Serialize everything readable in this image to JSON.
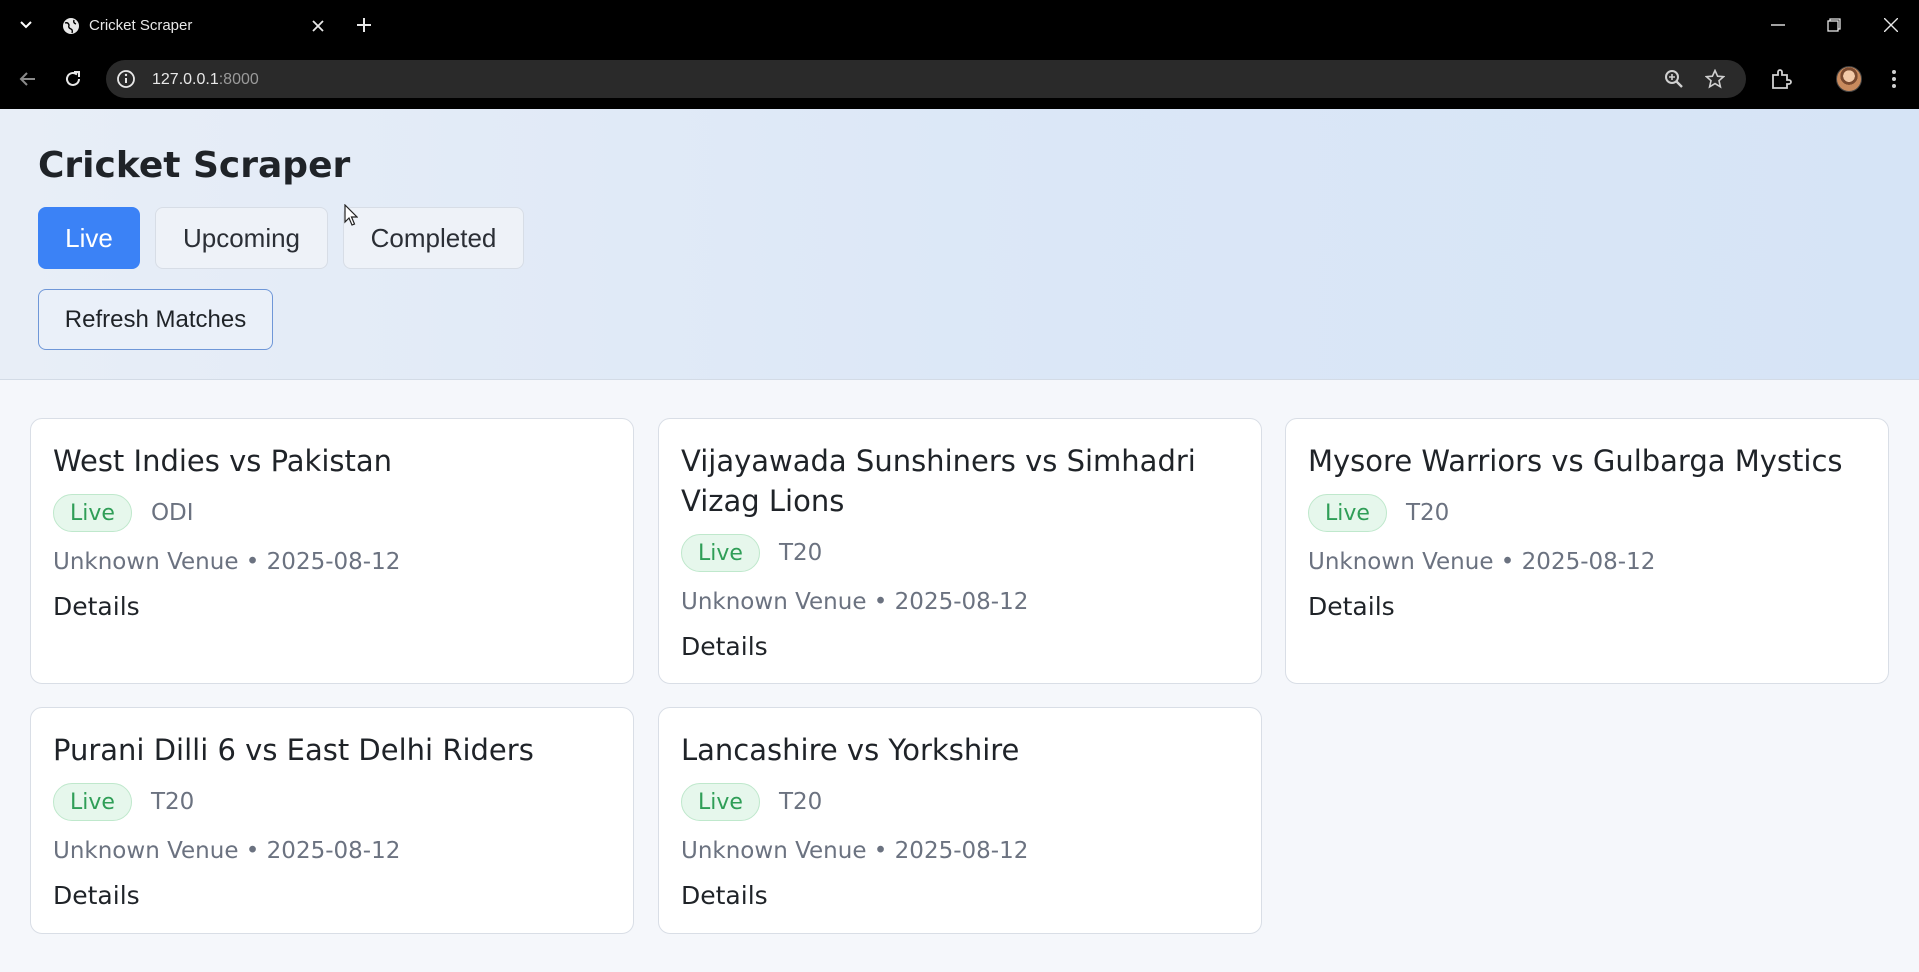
{
  "browser": {
    "tab_title": "Cricket Scraper",
    "url_host": "127.0.0.1",
    "url_port": ":8000"
  },
  "page": {
    "title": "Cricket Scraper",
    "filters": [
      {
        "label": "Live",
        "active": true
      },
      {
        "label": "Upcoming",
        "active": false
      },
      {
        "label": "Completed",
        "active": false
      }
    ],
    "refresh_label": "Refresh Matches"
  },
  "matches": [
    {
      "title": "West Indies vs Pakistan",
      "status": "Live",
      "format": "ODI",
      "venue_line": "Unknown Venue • 2025-08-12",
      "details": "Details"
    },
    {
      "title": "Vijayawada Sunshiners vs Simhadri Vizag Lions",
      "status": "Live",
      "format": "T20",
      "venue_line": "Unknown Venue • 2025-08-12",
      "details": "Details"
    },
    {
      "title": "Mysore Warriors vs Gulbarga Mystics",
      "status": "Live",
      "format": "T20",
      "venue_line": "Unknown Venue • 2025-08-12",
      "details": "Details"
    },
    {
      "title": "Purani Dilli 6 vs East Delhi Riders",
      "status": "Live",
      "format": "T20",
      "venue_line": "Unknown Venue • 2025-08-12",
      "details": "Details"
    },
    {
      "title": "Lancashire vs Yorkshire",
      "status": "Live",
      "format": "T20",
      "venue_line": "Unknown Venue • 2025-08-12",
      "details": "Details"
    }
  ],
  "colors": {
    "accent": "#3b82f6",
    "live_text": "#2f9e57",
    "live_bg": "#e6f7ec"
  },
  "icons": [
    "tab-list-icon",
    "globe-icon",
    "close-icon",
    "plus-icon",
    "minimize-icon",
    "restore-icon",
    "back-icon",
    "reload-icon",
    "info-icon",
    "zoom-icon",
    "star-icon",
    "extensions-icon",
    "kebab-menu-icon"
  ]
}
